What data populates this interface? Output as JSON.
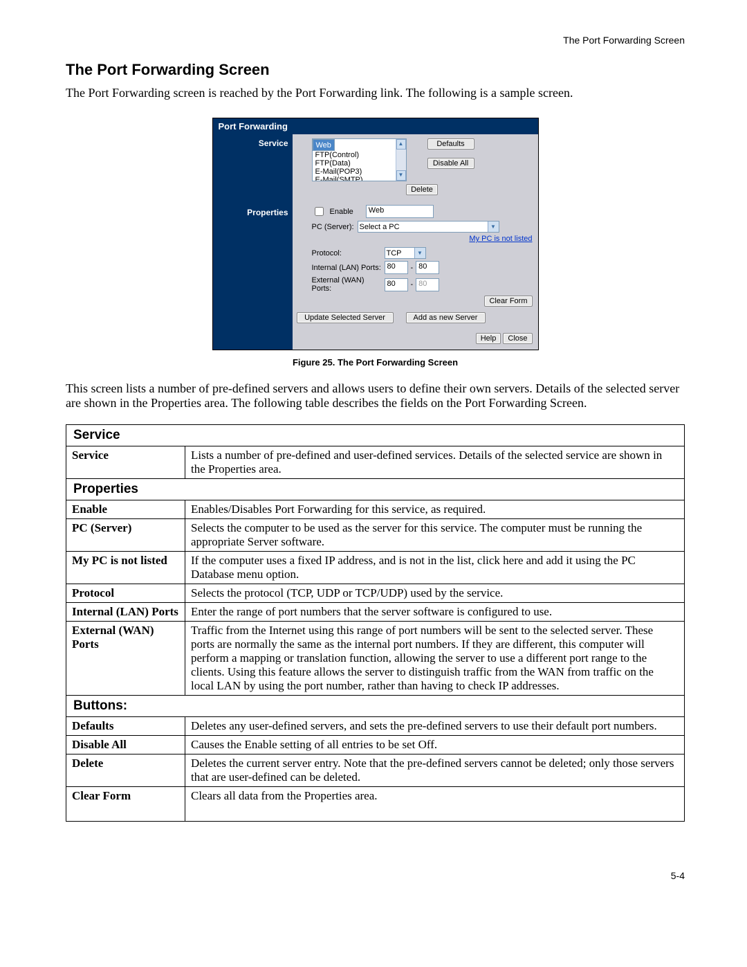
{
  "header": {
    "right": "The Port Forwarding Screen"
  },
  "title": "The Port Forwarding Screen",
  "intro": "The Port Forwarding screen is reached by the Port Forwarding link. The following is a sample screen.",
  "dialog": {
    "title": "Port Forwarding",
    "sidebar": {
      "service": "Service",
      "properties": "Properties"
    },
    "service_list": [
      "Web",
      "FTP(Control)",
      "FTP(Data)",
      "E-Mail(POP3)",
      "E-Mail(SMTP)"
    ],
    "buttons": {
      "defaults": "Defaults",
      "disable_all": "Disable All",
      "delete": "Delete",
      "clear_form": "Clear Form",
      "update_selected": "Update Selected Server",
      "add_new": "Add as new Server",
      "help": "Help",
      "close": "Close"
    },
    "properties": {
      "enable_label": "Enable",
      "enable_value": "Web",
      "pc_server_label": "PC (Server):",
      "pc_server_value": "Select a PC",
      "not_listed_link": "My PC is not listed",
      "protocol_label": "Protocol:",
      "protocol_value": "TCP",
      "internal_label": "Internal (LAN) Ports:",
      "internal_from": "80",
      "internal_to": "80",
      "external_label": "External (WAN) Ports:",
      "external_from": "80",
      "external_to": "80",
      "dash": "-"
    }
  },
  "caption": "Figure 25. The Port Forwarding Screen",
  "desc": "This screen lists a number of pre-defined servers and allows users to define their own servers. Details of the selected server are shown in the Properties area. The following table describes the fields on the Port Forwarding Screen.",
  "table": {
    "section_service": "Service",
    "section_properties": "Properties",
    "section_buttons": "Buttons:",
    "rows": {
      "service": {
        "k": "Service",
        "v": "Lists a number of pre-defined and user-defined services. Details of the selected service are shown in the Properties area."
      },
      "enable": {
        "k": "Enable",
        "v": "Enables/Disables Port Forwarding for this service, as required."
      },
      "pcserver": {
        "k": "PC (Server)",
        "v": "Selects the computer to be used as the server for this service. The computer must be running the appropriate Server software."
      },
      "notlisted": {
        "k": "My PC is not listed",
        "v": "If the computer uses a fixed IP address, and is not in the list, click here and add it using the PC Database menu option."
      },
      "protocol": {
        "k": "Protocol",
        "v": "Selects the protocol (TCP, UDP or TCP/UDP) used by the service."
      },
      "internal": {
        "k": "Internal (LAN) Ports",
        "v": "Enter the range of port numbers that the server software is configured to use."
      },
      "external": {
        "k": "External (WAN) Ports",
        "v": "Traffic from the Internet using this range of port numbers will be sent to the selected server. These ports are normally the same as the internal port numbers. If they are different, this computer will perform a mapping or translation function, allowing the server to use a different port range to the clients. Using this feature allows the server to distinguish traffic from the WAN from traffic on the local LAN by using the port number, rather than having to check IP addresses."
      },
      "defaults": {
        "k": "Defaults",
        "v": "Deletes any user-defined servers, and sets the pre-defined servers to use their default port numbers."
      },
      "disableall": {
        "k": "Disable All",
        "v": "Causes the Enable setting of all entries to be set Off."
      },
      "delete": {
        "k": "Delete",
        "v": "Deletes the current server entry. Note that the pre-defined servers cannot be deleted; only those servers that are user-defined can be deleted."
      },
      "clearform": {
        "k": "Clear Form",
        "v": "Clears all data from the Properties area."
      }
    }
  },
  "page_num": "5-4"
}
